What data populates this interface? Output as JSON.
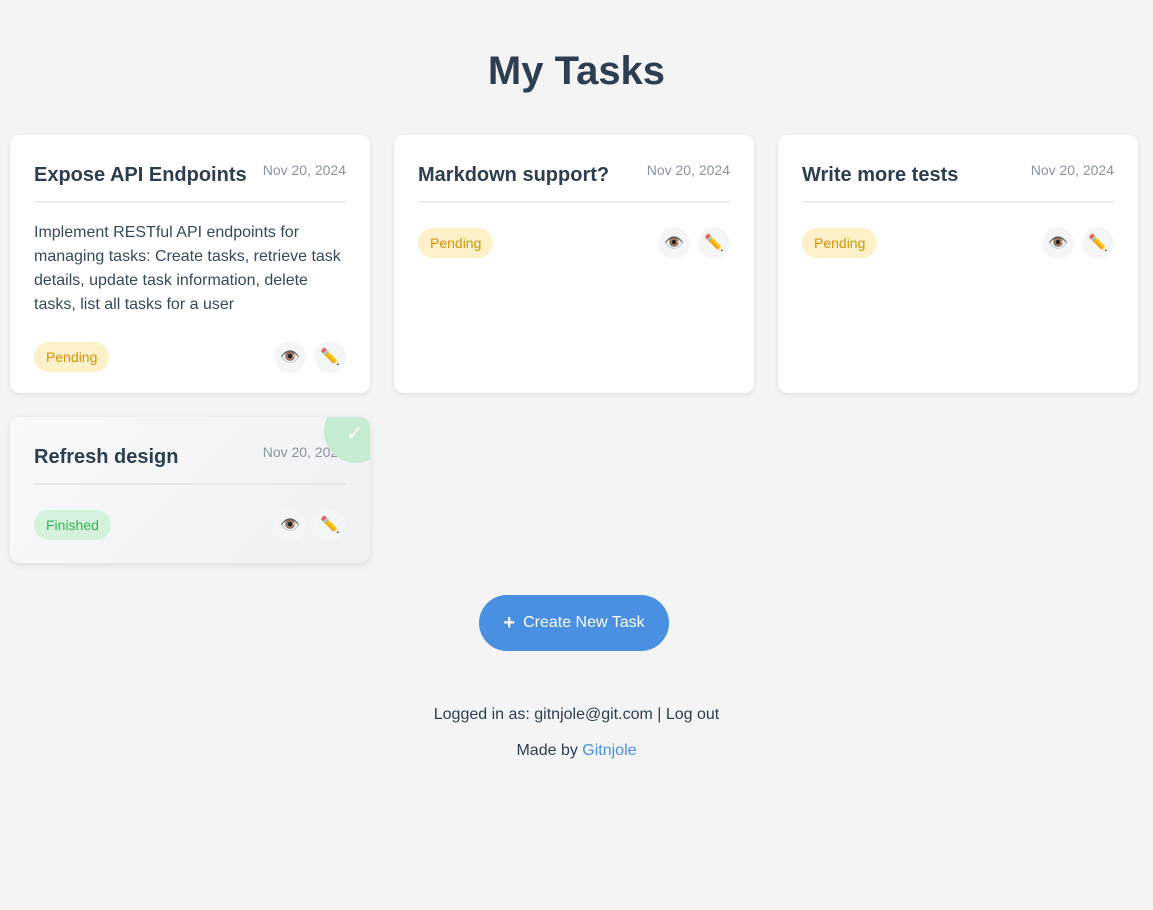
{
  "header": {
    "title": "My Tasks"
  },
  "tasks": [
    {
      "title": "Expose API Endpoints",
      "date": "Nov 20, 2024",
      "description": "Implement RESTful API endpoints for managing tasks: Create tasks, retrieve task details, update task information, delete tasks, list all tasks for a user",
      "status": "Pending"
    },
    {
      "title": "Markdown support?",
      "date": "Nov 20, 2024",
      "status": "Pending"
    },
    {
      "title": "Write more tests",
      "date": "Nov 20, 2024",
      "status": "Pending"
    },
    {
      "title": "Refresh design",
      "date": "Nov 20, 2024",
      "status": "Finished"
    }
  ],
  "icons": {
    "view": "👁️",
    "edit": "✏️",
    "check": "✓",
    "plus": "+"
  },
  "create_button": {
    "label": "Create New Task"
  },
  "footer": {
    "logged_in_prefix": "Logged in as: ",
    "user_email": "gitnjole@git.com",
    "separator": " | ",
    "logout_label": "Log out",
    "made_by_prefix": "Made by ",
    "author": "Gitnjole"
  },
  "colors": {
    "accent": "#4a90e2",
    "pending_bg": "#fdf1c9",
    "pending_text": "#d4920f",
    "finished_bg": "#d4f1dc",
    "finished_text": "#34b35a"
  }
}
